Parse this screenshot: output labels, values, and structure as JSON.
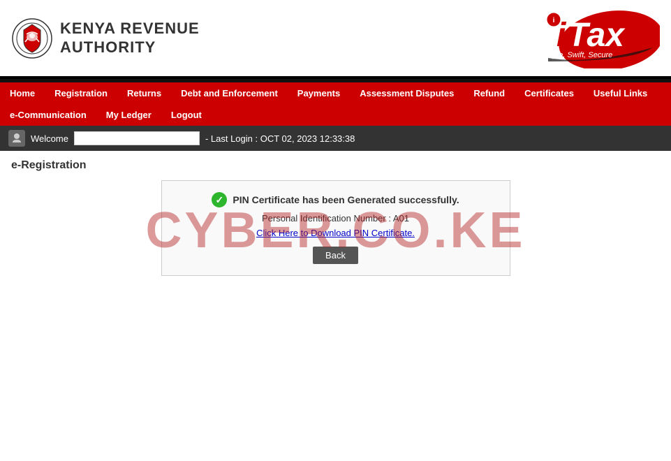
{
  "header": {
    "kra_line1": "Kenya Revenue",
    "kra_line2": "Authority",
    "itax_brand": "iTax",
    "itax_tagline": "Simple, Swift, Secure"
  },
  "navbar": {
    "row1": [
      {
        "label": "Home",
        "id": "home"
      },
      {
        "label": "Registration",
        "id": "registration"
      },
      {
        "label": "Returns",
        "id": "returns"
      },
      {
        "label": "Debt and Enforcement",
        "id": "debt"
      },
      {
        "label": "Payments",
        "id": "payments"
      },
      {
        "label": "Assessment Disputes",
        "id": "disputes"
      },
      {
        "label": "Refund",
        "id": "refund"
      },
      {
        "label": "Certificates",
        "id": "certificates"
      },
      {
        "label": "Useful Links",
        "id": "useful-links"
      }
    ],
    "row2": [
      {
        "label": "e-Communication",
        "id": "e-comm"
      },
      {
        "label": "My Ledger",
        "id": "ledger"
      },
      {
        "label": "Logout",
        "id": "logout"
      }
    ]
  },
  "welcome_bar": {
    "welcome_text": "Welcome",
    "username_value": "",
    "username_placeholder": "",
    "last_login": "- Last Login : OCT 02, 2023 12:33:38"
  },
  "page": {
    "title": "e-Registration"
  },
  "success_box": {
    "title": "PIN Certificate has been Generated successfully.",
    "pin_label": "Personal Identification Number : A01",
    "download_link": "Click Here to Download PIN Certificate.",
    "back_button": "Back"
  },
  "watermark": {
    "text": "CYBER.CO.KE"
  }
}
